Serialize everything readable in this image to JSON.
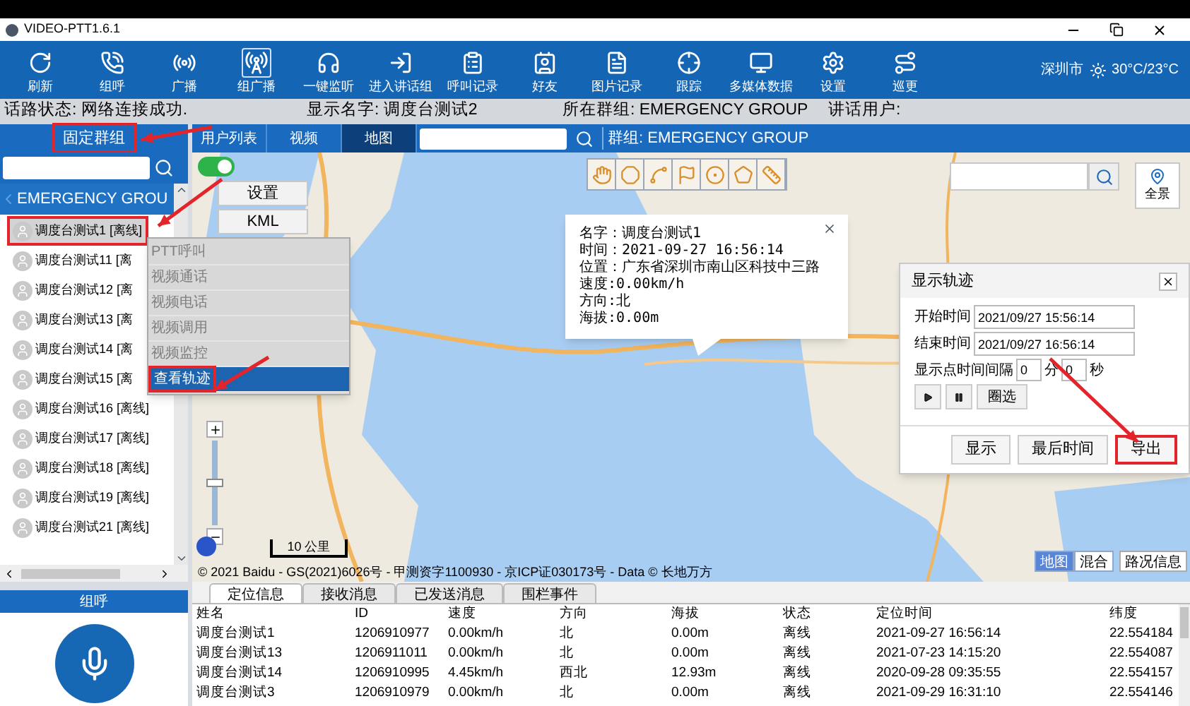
{
  "window": {
    "title": "VIDEO-PTT1.6.1"
  },
  "toolbar": {
    "items": [
      {
        "label": "刷新",
        "selected": false
      },
      {
        "label": "组呼",
        "selected": false
      },
      {
        "label": "广播",
        "selected": false
      },
      {
        "label": "组广播",
        "selected": true
      },
      {
        "label": "一键监听",
        "selected": false
      },
      {
        "label": "进入讲话组",
        "selected": false
      },
      {
        "label": "呼叫记录",
        "selected": false
      },
      {
        "label": "好友",
        "selected": false
      },
      {
        "label": "图片记录",
        "selected": false
      },
      {
        "label": "跟踪",
        "selected": false
      },
      {
        "label": "多媒体数据",
        "selected": false
      },
      {
        "label": "设置",
        "selected": false
      },
      {
        "label": "巡更",
        "selected": false
      }
    ],
    "weather": {
      "city": "深圳市",
      "temperature": "30°C/23°C"
    }
  },
  "status_bar": [
    "话路状态: 网络连接成功.",
    "显示名字: 调度台测试2",
    "所在群组: EMERGENCY GROUP",
    "讲话用户:"
  ],
  "group_panel": {
    "title": "固定群组",
    "highlighted": true
  },
  "view_tabs": [
    {
      "label": "用户列表",
      "selected": false
    },
    {
      "label": "视频",
      "selected": false
    },
    {
      "label": "地图",
      "selected": true
    }
  ],
  "group_label": "群组: EMERGENCY GROUP",
  "sidebar": {
    "group": "EMERGENCY GROU",
    "items": [
      {
        "label": "调度台测试1 [离线]",
        "selected": true,
        "highlighted": true
      },
      {
        "label": "调度台测试11 [离",
        "selected": false,
        "highlighted": false
      },
      {
        "label": "调度台测试12 [离",
        "selected": false,
        "highlighted": false
      },
      {
        "label": "调度台测试13 [离",
        "selected": false,
        "highlighted": false
      },
      {
        "label": "调度台测试14 [离",
        "selected": false,
        "highlighted": false
      },
      {
        "label": "调度台测试15 [离",
        "selected": false,
        "highlighted": false
      },
      {
        "label": "调度台测试16 [离线]",
        "selected": false,
        "highlighted": false
      },
      {
        "label": "调度台测试17 [离线]",
        "selected": false,
        "highlighted": false
      },
      {
        "label": "调度台测试18 [离线]",
        "selected": false,
        "highlighted": false
      },
      {
        "label": "调度台测试19 [离线]",
        "selected": false,
        "highlighted": false
      },
      {
        "label": "调度台测试21 [离线]",
        "selected": false,
        "highlighted": false
      }
    ]
  },
  "context_menu": [
    {
      "label": "PTT呼叫",
      "disabled": true,
      "selected": false,
      "highlighted": false
    },
    {
      "label": "视频通话",
      "disabled": true,
      "selected": false,
      "highlighted": false
    },
    {
      "label": "视频电话",
      "disabled": true,
      "selected": false,
      "highlighted": false
    },
    {
      "label": "视频调用",
      "disabled": true,
      "selected": false,
      "highlighted": false
    },
    {
      "label": "视频监控",
      "disabled": true,
      "selected": false,
      "highlighted": false
    },
    {
      "label": "查看轨迹",
      "disabled": false,
      "selected": true,
      "highlighted": true
    }
  ],
  "map": {
    "layer_toggle": {
      "on": true
    },
    "zoom_slider": {
      "level": 0.5
    },
    "buttons": [
      "设置",
      "KML"
    ],
    "info_popup": {
      "lines": [
        "名字：调度台测试1",
        "时间：2021-09-27 16:56:14",
        "位置：广东省深圳市南山区科技中三路",
        "速度:0.00km/h",
        "方向:北",
        "海拔:0.00m"
      ]
    },
    "panorama": "全景",
    "scale": "10 公里",
    "copyright": "© 2021 Baidu - GS(2021)6026号 - 甲测资字1100930 - 京ICP证030173号 - Data © 长地万方",
    "map_types": [
      {
        "label": "地图",
        "selected": true
      },
      {
        "label": "混合",
        "selected": false
      }
    ],
    "traffic": "路况信息"
  },
  "track_dialog": {
    "title": "显示轨迹",
    "fields": [
      {
        "label": "开始时间",
        "value": "2021/09/27 15:56:14"
      },
      {
        "label": "结束时间",
        "value": "2021/09/27 16:56:14"
      }
    ],
    "interval": {
      "label": "显示点时间间隔",
      "minutes": "0",
      "minutes_unit": "分",
      "seconds": "0",
      "seconds_unit": "秒"
    },
    "select_button": "圈选",
    "buttons": [
      {
        "label": "显示",
        "highlighted": false
      },
      {
        "label": "最后时间",
        "highlighted": false
      },
      {
        "label": "导出",
        "highlighted": true
      }
    ]
  },
  "bottom_tabs": [
    {
      "label": "定位信息",
      "selected": true
    },
    {
      "label": "接收消息",
      "selected": false
    },
    {
      "label": "已发送消息",
      "selected": false
    },
    {
      "label": "围栏事件",
      "selected": false
    }
  ],
  "table": {
    "columns": [
      "姓名",
      "ID",
      "速度",
      "方向",
      "海拔",
      "状态",
      "定位时间",
      "纬度"
    ],
    "rows": [
      [
        "调度台测试1",
        "1206910977",
        "0.00km/h",
        "北",
        "0.00m",
        "离线",
        "2021-09-27 16:56:14",
        "22.554184"
      ],
      [
        "调度台测试13",
        "1206911011",
        "0.00km/h",
        "北",
        "0.00m",
        "离线",
        "2021-07-23 14:15:20",
        "22.554087"
      ],
      [
        "调度台测试14",
        "1206910995",
        "4.45km/h",
        "西北",
        "12.93m",
        "离线",
        "2020-09-28 09:35:55",
        "22.554157"
      ],
      [
        "调度台测试3",
        "1206910979",
        "0.00km/h",
        "北",
        "0.00m",
        "离线",
        "2021-09-29 16:31:10",
        "22.554146"
      ]
    ]
  },
  "group_call": {
    "title": "组呼"
  }
}
